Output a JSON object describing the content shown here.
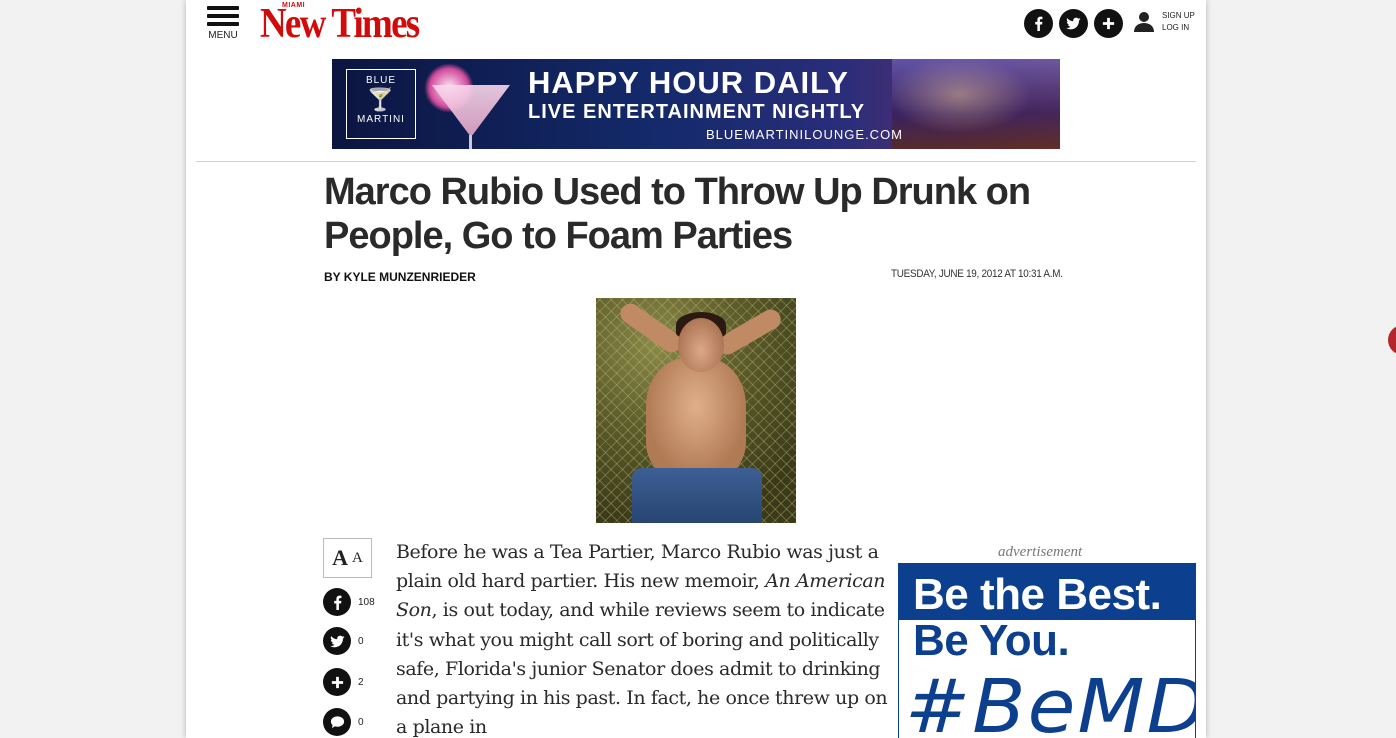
{
  "header": {
    "menu_label": "MENU",
    "logo_small": "MIAMI",
    "logo_name": "New Times",
    "sign_up": "SIGN UP",
    "log_in": "LOG IN"
  },
  "top_ad": {
    "brand_line1": "BLUE",
    "brand_line2": "MARTINI",
    "headline": "HAPPY HOUR DAILY",
    "subhead": "LIVE ENTERTAINMENT NIGHTLY",
    "url": "BLUEMARTINILOUNGE.COM"
  },
  "article": {
    "title": "Marco Rubio Used to Throw Up Drunk on People, Go to Foam Parties",
    "byline_prefix": "BY",
    "author": "KYLE MUNZENRIEDER",
    "date": "TUESDAY, JUNE 19, 2012 AT 10:31 A.M.",
    "body_1": "Before he was a Tea Partier, Marco Rubio was just a plain old hard partier. His new memoir, ",
    "body_italic": "An American Son",
    "body_2": ", is out today, and while reviews seem to indicate it's what you might call sort of boring and politically safe, Florida's junior Senator does admit to drinking and partying in his past. In fact, he once threw up on a plane in"
  },
  "share": {
    "text_size_big": "A",
    "text_size_small": "A",
    "facebook_count": "108",
    "twitter_count": "0",
    "plus_count": "2",
    "comment_count": "0"
  },
  "right_ad": {
    "label": "advertisement",
    "line1": "Be the Best.",
    "line2": "Be You.",
    "line3": "#BeMDC"
  },
  "colors": {
    "logo_red": "#d10a0a",
    "mdc_blue": "#0d3f8f",
    "text_dark": "#2a2a2a"
  },
  "icons": [
    "menu-icon",
    "facebook-icon",
    "twitter-icon",
    "plus-icon",
    "user-icon",
    "comment-icon"
  ]
}
